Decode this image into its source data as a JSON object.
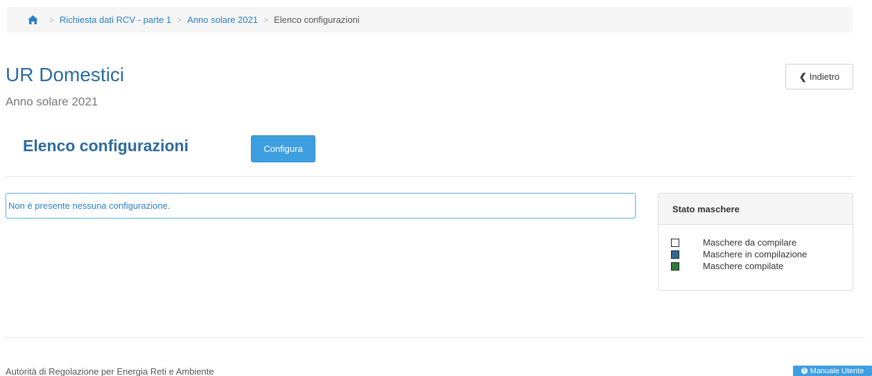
{
  "breadcrumb": {
    "home_icon": "home-icon",
    "items": [
      {
        "label": "Richiesta dati RCV - parte 1"
      },
      {
        "label": "Anno solare 2021"
      }
    ],
    "current": "Elenco configurazioni",
    "separator": ">"
  },
  "header": {
    "title": "UR Domestici",
    "subtitle": "Anno solare 2021",
    "back_label": "Indietro",
    "back_icon": "chevron-left-icon"
  },
  "section": {
    "title": "Elenco configurazioni",
    "configure_label": "Configura"
  },
  "info_message": "Non è presente nessuna configurazione.",
  "status_panel": {
    "title": "Stato maschere",
    "legend": [
      {
        "label": "Maschere da compilare",
        "color": "#ffffff"
      },
      {
        "label": "Maschere in compilazione",
        "color": "#2f6a94"
      },
      {
        "label": "Maschere compilate",
        "color": "#2e7d32"
      }
    ]
  },
  "footer": {
    "organization": "Autorità di Regolazione per Energia Reti e Ambiente",
    "manual_label": "Manuale Utente",
    "manual_icon": "question-circle-icon"
  },
  "colors": {
    "accent": "#3d9ee0",
    "title": "#2d6a9f",
    "link": "#2a7fc9"
  }
}
